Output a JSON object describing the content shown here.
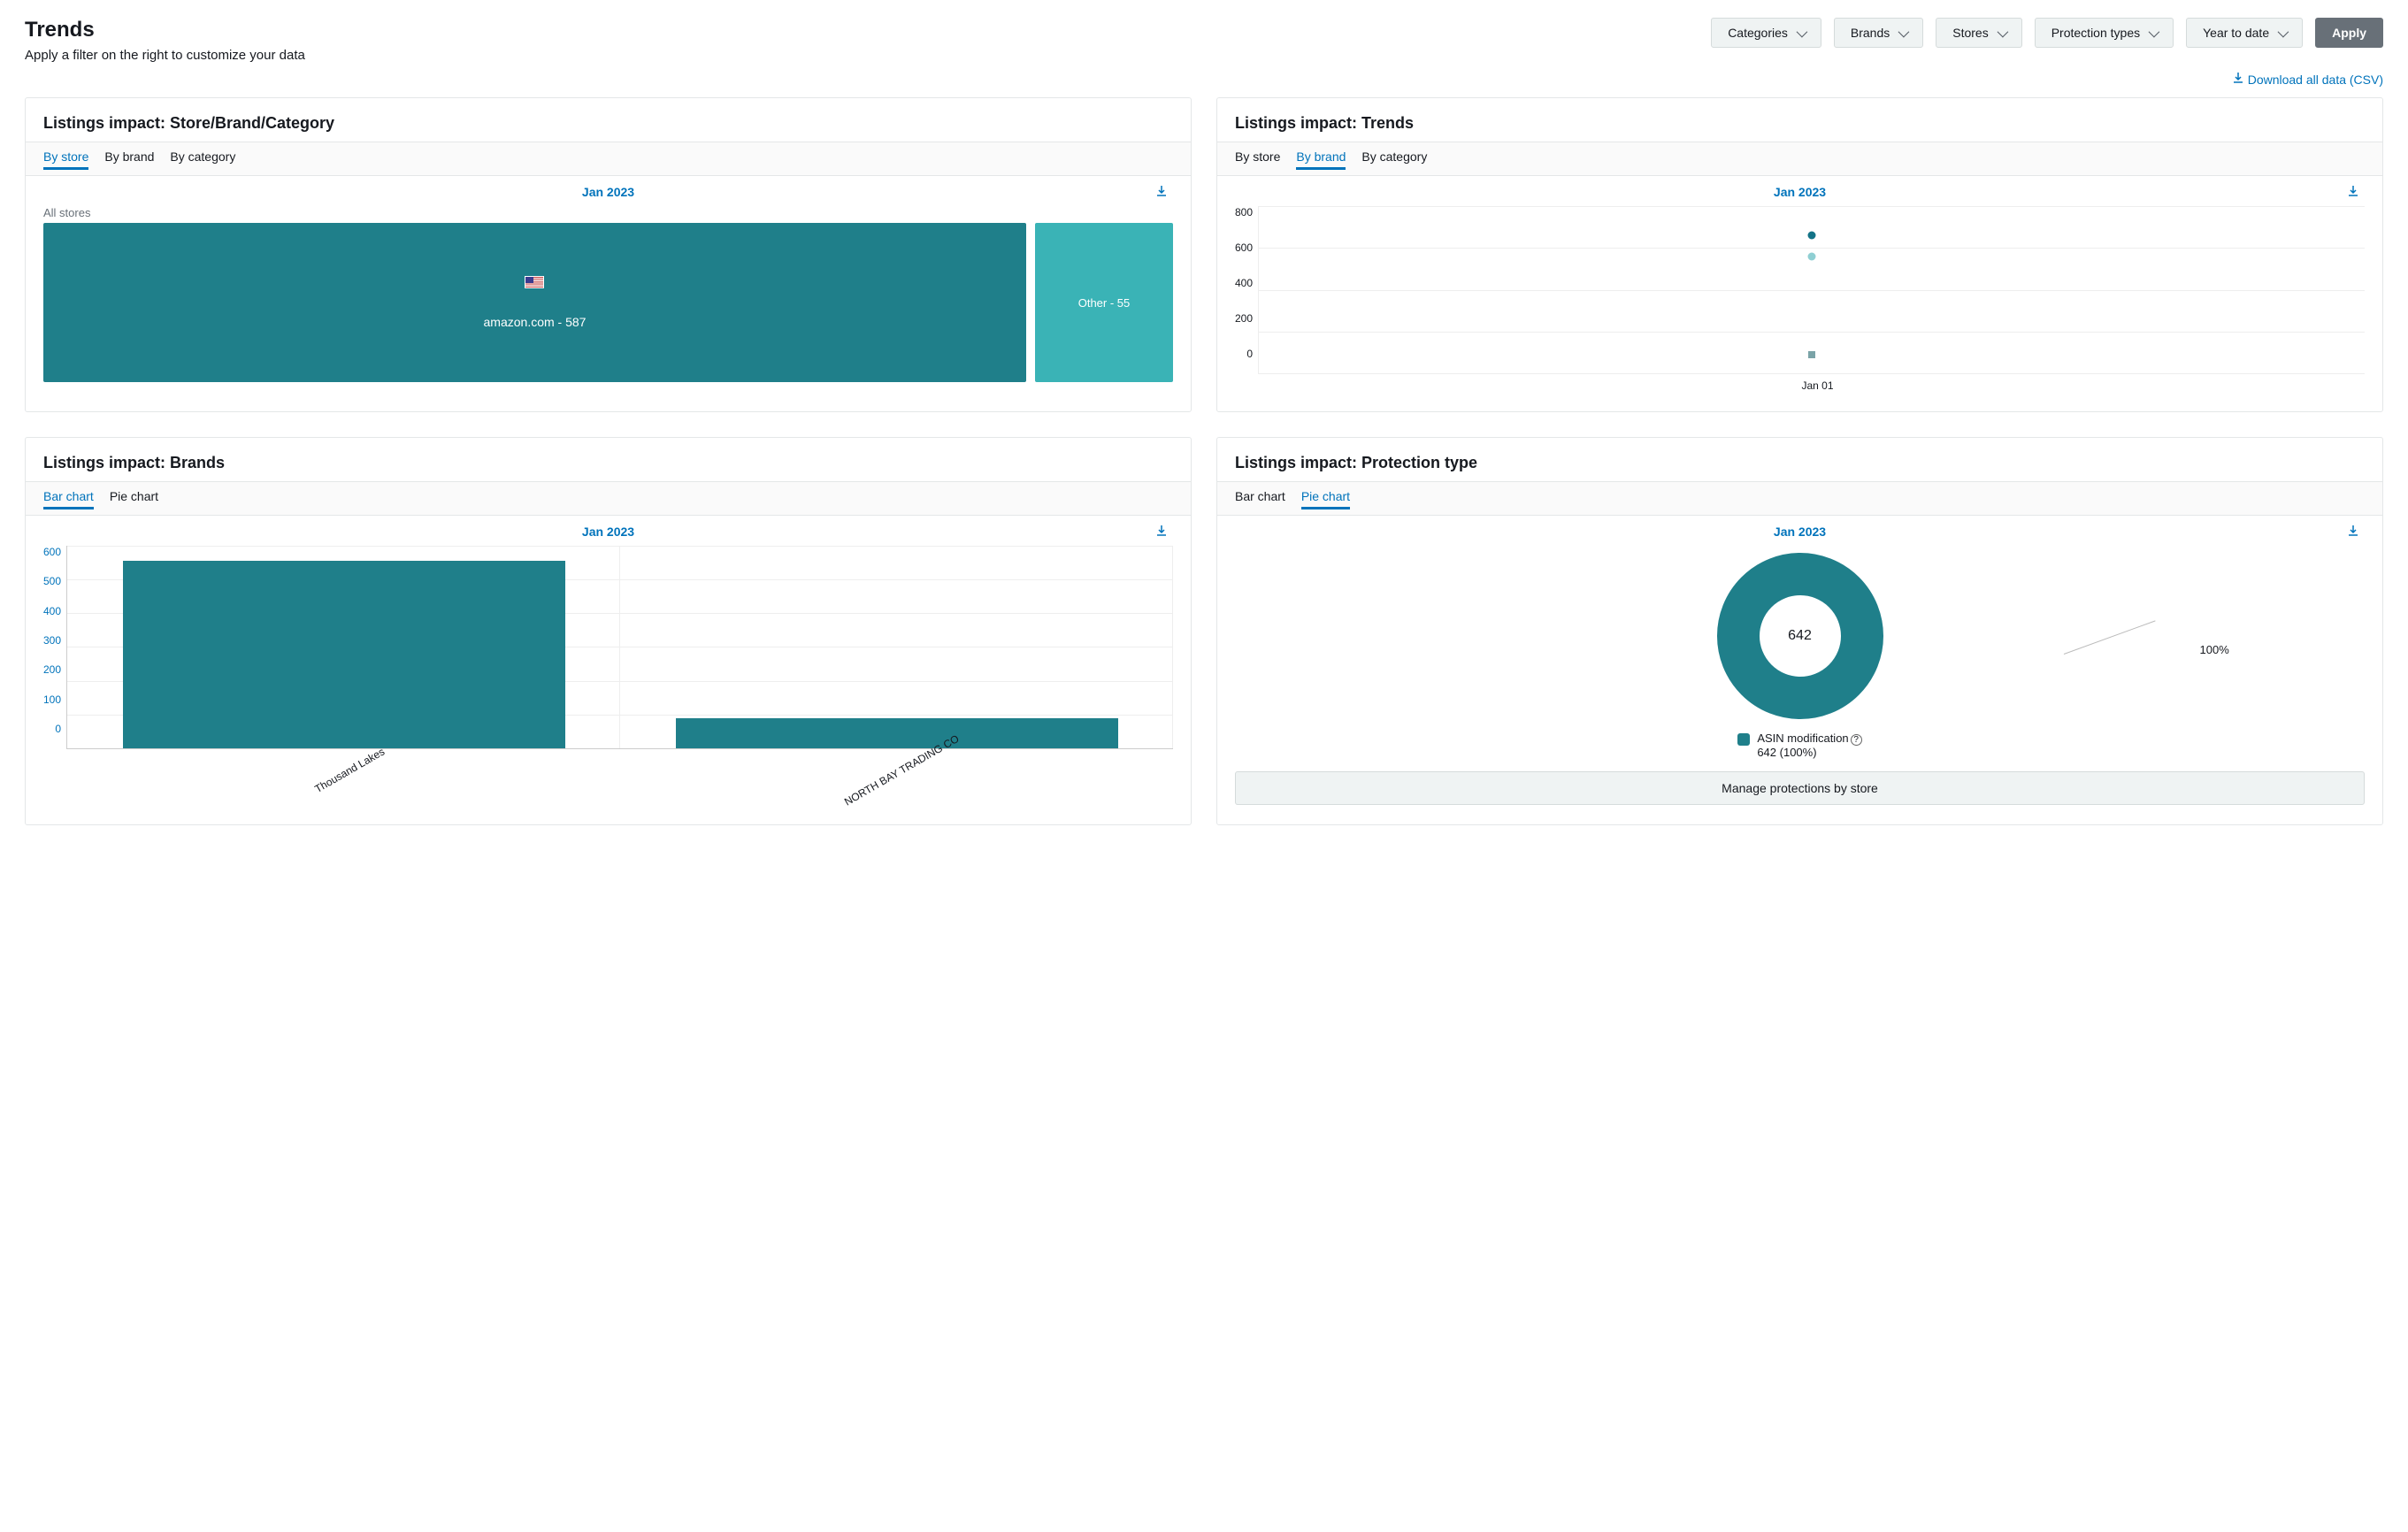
{
  "page": {
    "title": "Trends",
    "subtitle": "Apply a filter on the right to customize your data"
  },
  "filters": {
    "categories": "Categories",
    "brands": "Brands",
    "stores": "Stores",
    "protection": "Protection types",
    "range": "Year to date",
    "apply": "Apply"
  },
  "download_all": "Download all data (CSV)",
  "cards": {
    "sbc": {
      "title": "Listings impact: Store/Brand/Category",
      "tabs": {
        "store": "By store",
        "brand": "By brand",
        "category": "By category"
      },
      "date": "Jan 2023",
      "all_stores": "All stores",
      "big": "amazon.com - 587",
      "small": "Other - 55"
    },
    "trends": {
      "title": "Listings impact: Trends",
      "tabs": {
        "store": "By store",
        "brand": "By brand",
        "category": "By category"
      },
      "date": "Jan 2023",
      "yticks": {
        "t0": "0",
        "t200": "200",
        "t400": "400",
        "t600": "600",
        "t800": "800"
      },
      "xlabel": "Jan 01"
    },
    "brands": {
      "title": "Listings impact: Brands",
      "tabs": {
        "bar": "Bar chart",
        "pie": "Pie chart"
      },
      "date": "Jan 2023",
      "yticks": {
        "t0": "0",
        "t100": "100",
        "t200": "200",
        "t300": "300",
        "t400": "400",
        "t500": "500",
        "t600": "600"
      },
      "x1": "Thousand Lakes",
      "x2": "NORTH BAY TRADING CO"
    },
    "ptype": {
      "title": "Listings impact: Protection type",
      "tabs": {
        "bar": "Bar chart",
        "pie": "Pie chart"
      },
      "date": "Jan 2023",
      "center": "642",
      "pct": "100%",
      "legend_top": "ASIN modification",
      "legend_bot": "642 (100%)",
      "button": "Manage protections by store"
    }
  },
  "chart_data": [
    {
      "id": "store_treemap",
      "type": "treemap",
      "title": "Listings impact: Store/Brand/Category — Jan 2023 — By store",
      "items": [
        {
          "label": "amazon.com",
          "value": 587
        },
        {
          "label": "Other",
          "value": 55
        }
      ]
    },
    {
      "id": "trends_scatter",
      "type": "scatter",
      "title": "Listings impact: Trends — Jan 2023 — By brand",
      "x": [
        "Jan 01"
      ],
      "series": [
        {
          "name": "series-a",
          "values": [
            660
          ],
          "marker": "circle",
          "color": "#137387"
        },
        {
          "name": "series-b",
          "values": [
            560
          ],
          "marker": "circle",
          "color": "#6cc0c9"
        },
        {
          "name": "series-c",
          "values": [
            90
          ],
          "marker": "square",
          "color": "#7aa3a7"
        }
      ],
      "ylim": [
        0,
        800
      ],
      "yticks": [
        0,
        200,
        400,
        600,
        800
      ]
    },
    {
      "id": "brands_bar",
      "type": "bar",
      "title": "Listings impact: Brands — Jan 2023",
      "categories": [
        "Thousand Lakes",
        "NORTH BAY TRADING CO"
      ],
      "values": [
        555,
        90
      ],
      "ylim": [
        0,
        600
      ],
      "yticks": [
        0,
        100,
        200,
        300,
        400,
        500,
        600
      ]
    },
    {
      "id": "protection_pie",
      "type": "pie",
      "title": "Listings impact: Protection type — Jan 2023",
      "slices": [
        {
          "label": "ASIN modification",
          "value": 642,
          "pct": 100
        }
      ],
      "total": 642
    }
  ]
}
